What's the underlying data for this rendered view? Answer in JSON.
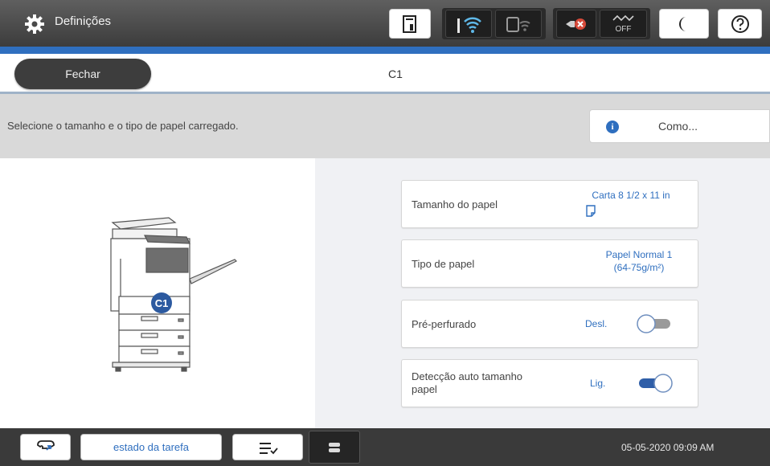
{
  "header": {
    "title": "Definições"
  },
  "nav": {
    "close_label": "Fechar",
    "location_label": "C1"
  },
  "instruction": {
    "text": "Selecione o tamanho e o tipo de papel carregado.",
    "how_label": "Como..."
  },
  "illustration": {
    "tray_badge": "C1"
  },
  "settings": {
    "paper_size": {
      "label": "Tamanho do papel",
      "value": "Carta 8 1/2 x 11 in"
    },
    "paper_type": {
      "label": "Tipo de papel",
      "value_line1": "Papel Normal 1",
      "value_line2": "(64-75g/m²)"
    },
    "prepunched": {
      "label": "Pré-perfurado",
      "value": "Desl.",
      "on": false
    },
    "auto_detect": {
      "label_line1": "Detecção auto tamanho",
      "label_line2": "papel",
      "value": "Lig.",
      "on": true
    }
  },
  "status_icons": {
    "wifi_off_text": "OFF"
  },
  "footer": {
    "job_status_label": "estado da tarefa",
    "datetime": "05-05-2020 09:09 AM"
  },
  "colors": {
    "accent": "#2f6fbf",
    "header_bg": "#4a4a4a",
    "instruction_bg": "#d9d9d9",
    "panel_bg": "#f0f1f4"
  },
  "icons": [
    "gear-icon",
    "toner-icon",
    "wifi-icon",
    "wifi-direct-icon",
    "fax-error-icon",
    "wifi-off-icon",
    "sleep-moon-icon",
    "help-icon",
    "info-icon",
    "paper-size-icon",
    "fax-icon",
    "job-queue-icon",
    "stop-icon"
  ]
}
